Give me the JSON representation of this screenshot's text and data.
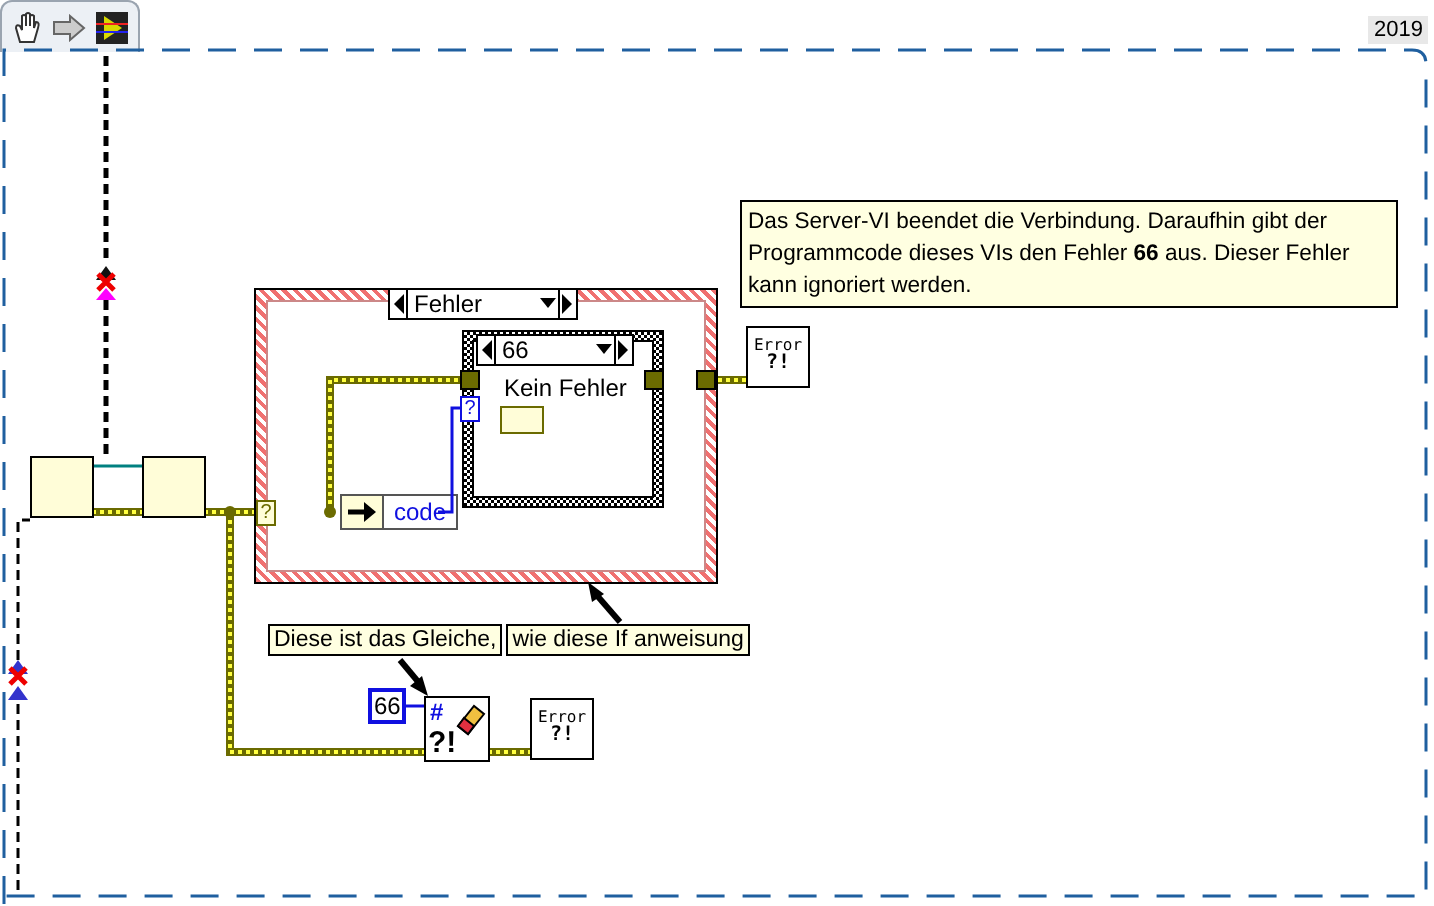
{
  "window": {
    "year_label": "2019"
  },
  "case_structure": {
    "selector": "Fehler",
    "tunnel": "?",
    "unbundle_field": "code",
    "terminal": "?",
    "inner_case": {
      "selector": "66",
      "label": "Kein Fehler"
    }
  },
  "comment": "Das Server-VI beendet die Verbindung. Daraufhin gibt der Programmcode dieses VIs den Fehler **66** aus. Dieser Fehler kann ignoriert werden.",
  "labels": [
    "Diese ist das Gleiche,",
    "wie diese If anweisung"
  ],
  "constant": "66",
  "clear_errors": {
    "mark": "#",
    "symbol": "?!"
  },
  "error_handlers": [
    {
      "label": "Error",
      "symbol": "?!"
    },
    {
      "label": "Error",
      "symbol": "?!"
    }
  ]
}
